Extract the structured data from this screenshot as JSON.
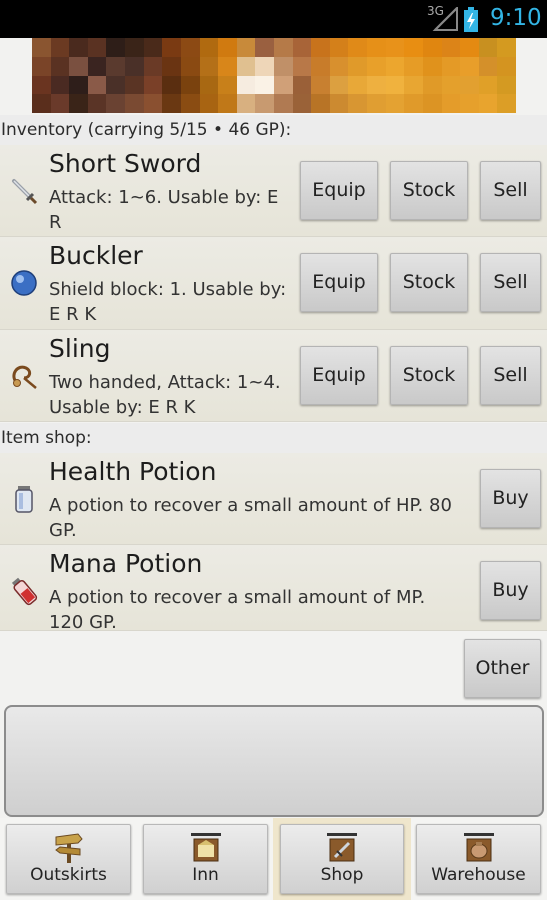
{
  "status_bar": {
    "network_label": "3G",
    "time": "9:10",
    "accent_color": "#33b5e5"
  },
  "inventory": {
    "header": "Inventory (carrying 5/15 • 46 GP):",
    "items": [
      {
        "icon": "sword-icon",
        "name": "Short Sword",
        "description": "Attack: 1~6. Usable by: E R",
        "buttons": [
          "Equip",
          "Stock",
          "Sell"
        ]
      },
      {
        "icon": "buckler-icon",
        "name": "Buckler",
        "description": "Shield block: 1. Usable by: E R K",
        "buttons": [
          "Equip",
          "Stock",
          "Sell"
        ]
      },
      {
        "icon": "sling-icon",
        "name": "Sling",
        "description": "Two handed, Attack: 1~4. Usable by: E R K",
        "buttons": [
          "Equip",
          "Stock",
          "Sell"
        ]
      }
    ]
  },
  "item_shop": {
    "header": "Item shop:",
    "items": [
      {
        "icon": "health-potion-icon",
        "name": "Health Potion",
        "description": "A potion to recover a small amount of HP. 80 GP.",
        "button": "Buy"
      },
      {
        "icon": "mana-potion-icon",
        "name": "Mana Potion",
        "description": "A potion to recover a small amount of MP. 120 GP.",
        "button": "Buy"
      }
    ]
  },
  "other_button": "Other",
  "message": "",
  "nav": {
    "selected": "Shop",
    "items": [
      {
        "label": "Outskirts",
        "icon": "signpost-icon"
      },
      {
        "label": "Inn",
        "icon": "inn-sign-icon"
      },
      {
        "label": "Shop",
        "icon": "shop-sign-icon"
      },
      {
        "label": "Warehouse",
        "icon": "warehouse-sign-icon"
      }
    ]
  }
}
